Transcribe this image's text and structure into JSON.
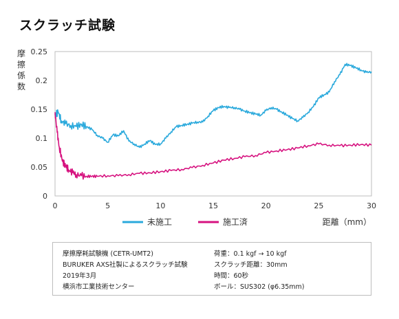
{
  "page": {
    "title": "スクラッチ試験"
  },
  "chart_data": {
    "type": "line",
    "ylabel": "摩擦係数",
    "xlabel": "距離（mm）",
    "xlim": [
      0,
      30
    ],
    "ylim": [
      0,
      0.25
    ],
    "x_ticks": [
      0,
      5,
      10,
      15,
      20,
      25,
      30
    ],
    "x_tick_labels": [
      "0",
      "5",
      "10",
      "15",
      "20",
      "25",
      "30"
    ],
    "y_ticks": [
      0,
      0.05,
      0.1,
      0.15,
      0.2,
      0.25
    ],
    "y_tick_labels": [
      "0",
      "0.05",
      "0.1",
      "0.15",
      "0.2",
      "0.25"
    ],
    "grid": false,
    "legend_position": "bottom",
    "series": [
      {
        "name": "未施工",
        "color": "#2aa9dc",
        "points": [
          [
            0,
            0.14
          ],
          [
            0.3,
            0.145
          ],
          [
            0.6,
            0.13
          ],
          [
            1.0,
            0.125
          ],
          [
            1.5,
            0.122
          ],
          [
            2,
            0.12
          ],
          [
            2.5,
            0.124
          ],
          [
            3,
            0.12
          ],
          [
            3.5,
            0.115
          ],
          [
            4,
            0.105
          ],
          [
            4.5,
            0.1
          ],
          [
            5,
            0.093
          ],
          [
            5.5,
            0.106
          ],
          [
            6,
            0.104
          ],
          [
            6.5,
            0.113
          ],
          [
            7,
            0.095
          ],
          [
            7.5,
            0.09
          ],
          [
            8,
            0.084
          ],
          [
            8.5,
            0.09
          ],
          [
            9,
            0.096
          ],
          [
            9.5,
            0.089
          ],
          [
            10,
            0.09
          ],
          [
            10.5,
            0.1
          ],
          [
            11,
            0.111
          ],
          [
            11.5,
            0.12
          ],
          [
            12,
            0.122
          ],
          [
            12.5,
            0.124
          ],
          [
            13,
            0.126
          ],
          [
            13.5,
            0.128
          ],
          [
            14,
            0.128
          ],
          [
            14.5,
            0.138
          ],
          [
            15,
            0.148
          ],
          [
            15.5,
            0.153
          ],
          [
            16,
            0.155
          ],
          [
            16.5,
            0.153
          ],
          [
            17,
            0.153
          ],
          [
            17.5,
            0.15
          ],
          [
            18,
            0.147
          ],
          [
            18.5,
            0.144
          ],
          [
            19,
            0.142
          ],
          [
            19.5,
            0.14
          ],
          [
            20,
            0.148
          ],
          [
            20.5,
            0.153
          ],
          [
            21,
            0.15
          ],
          [
            21.5,
            0.145
          ],
          [
            22,
            0.14
          ],
          [
            22.5,
            0.134
          ],
          [
            23,
            0.13
          ],
          [
            23.5,
            0.136
          ],
          [
            24,
            0.145
          ],
          [
            24.5,
            0.155
          ],
          [
            25,
            0.17
          ],
          [
            25.5,
            0.175
          ],
          [
            26,
            0.18
          ],
          [
            26.5,
            0.198
          ],
          [
            27,
            0.21
          ],
          [
            27.5,
            0.228
          ],
          [
            28,
            0.226
          ],
          [
            28.5,
            0.222
          ],
          [
            29,
            0.218
          ],
          [
            29.5,
            0.214
          ],
          [
            30,
            0.215
          ]
        ]
      },
      {
        "name": "施工済",
        "color": "#d6127f",
        "points": [
          [
            0,
            0.145
          ],
          [
            0.2,
            0.11
          ],
          [
            0.4,
            0.085
          ],
          [
            0.7,
            0.06
          ],
          [
            1.0,
            0.052
          ],
          [
            1.3,
            0.045
          ],
          [
            1.7,
            0.04
          ],
          [
            2,
            0.037
          ],
          [
            2.5,
            0.035
          ],
          [
            3,
            0.034
          ],
          [
            3.5,
            0.034
          ],
          [
            4,
            0.034
          ],
          [
            5,
            0.035
          ],
          [
            6,
            0.035
          ],
          [
            7,
            0.037
          ],
          [
            8,
            0.039
          ],
          [
            9,
            0.04
          ],
          [
            10,
            0.042
          ],
          [
            11,
            0.044
          ],
          [
            12,
            0.046
          ],
          [
            13,
            0.049
          ],
          [
            14,
            0.053
          ],
          [
            15,
            0.057
          ],
          [
            16,
            0.062
          ],
          [
            17,
            0.065
          ],
          [
            18,
            0.068
          ],
          [
            19,
            0.07
          ],
          [
            20,
            0.075
          ],
          [
            21,
            0.078
          ],
          [
            22,
            0.08
          ],
          [
            23,
            0.083
          ],
          [
            24,
            0.087
          ],
          [
            25,
            0.09
          ],
          [
            26,
            0.088
          ],
          [
            27,
            0.087
          ],
          [
            28,
            0.088
          ],
          [
            29,
            0.089
          ],
          [
            30,
            0.088
          ]
        ]
      }
    ]
  },
  "info": {
    "left": [
      "摩擦摩耗試験機 (CETR-UMT2)",
      "BURUKER AXS社製によるスクラッチ試験",
      "2019年3月",
      "横浜市工業技術センター"
    ],
    "right": [
      "荷重：0.1 kgf → 10 kgf",
      "スクラッチ距離：30mm",
      "時間：60秒",
      "ボール：SUS302 (φ6.35mm)"
    ]
  }
}
